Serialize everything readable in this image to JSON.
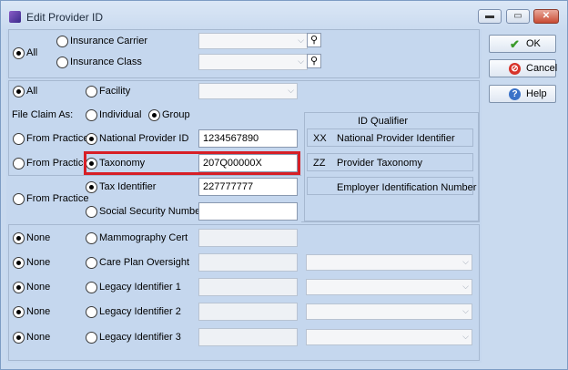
{
  "window": {
    "title": "Edit Provider ID",
    "min_glyph": "▬",
    "max_glyph": "▭",
    "close_glyph": "✕"
  },
  "buttons": {
    "ok": {
      "label": "OK",
      "icon": "check-icon"
    },
    "cancel": {
      "label": "Cancel",
      "icon": "cancel-icon"
    },
    "help": {
      "label": "Help",
      "icon": "help-icon"
    }
  },
  "section1": {
    "all_label": "All",
    "insurance_carrier": "Insurance Carrier",
    "insurance_class": "Insurance Class"
  },
  "section2": {
    "all_label": "All",
    "facility": "Facility",
    "file_claim_as": "File Claim As:",
    "individual": "Individual",
    "group": "Group"
  },
  "qualifier": {
    "header": "ID Qualifier",
    "rows": [
      {
        "code": "XX",
        "desc": "National Provider Identifier"
      },
      {
        "code": "ZZ",
        "desc": "Provider Taxonomy"
      },
      {
        "code": "",
        "desc": "Employer Identification Number"
      }
    ]
  },
  "ids": {
    "from_practice": "From Practice",
    "npi": {
      "label": "National Provider ID",
      "value": "1234567890"
    },
    "taxonomy": {
      "label": "Taxonomy",
      "value": "207Q00000X"
    },
    "tax_identifier": {
      "label": "Tax Identifier",
      "value": "227777777"
    },
    "ssn": {
      "label": "Social Security Number",
      "value": ""
    }
  },
  "other": {
    "none": "None",
    "mammography": "Mammography Cert",
    "care_plan": "Care Plan Oversight",
    "legacy1": "Legacy Identifier 1",
    "legacy2": "Legacy Identifier 2",
    "legacy3": "Legacy Identifier 3"
  },
  "combo_arrow": "⌵",
  "search_glyph": "⚲"
}
